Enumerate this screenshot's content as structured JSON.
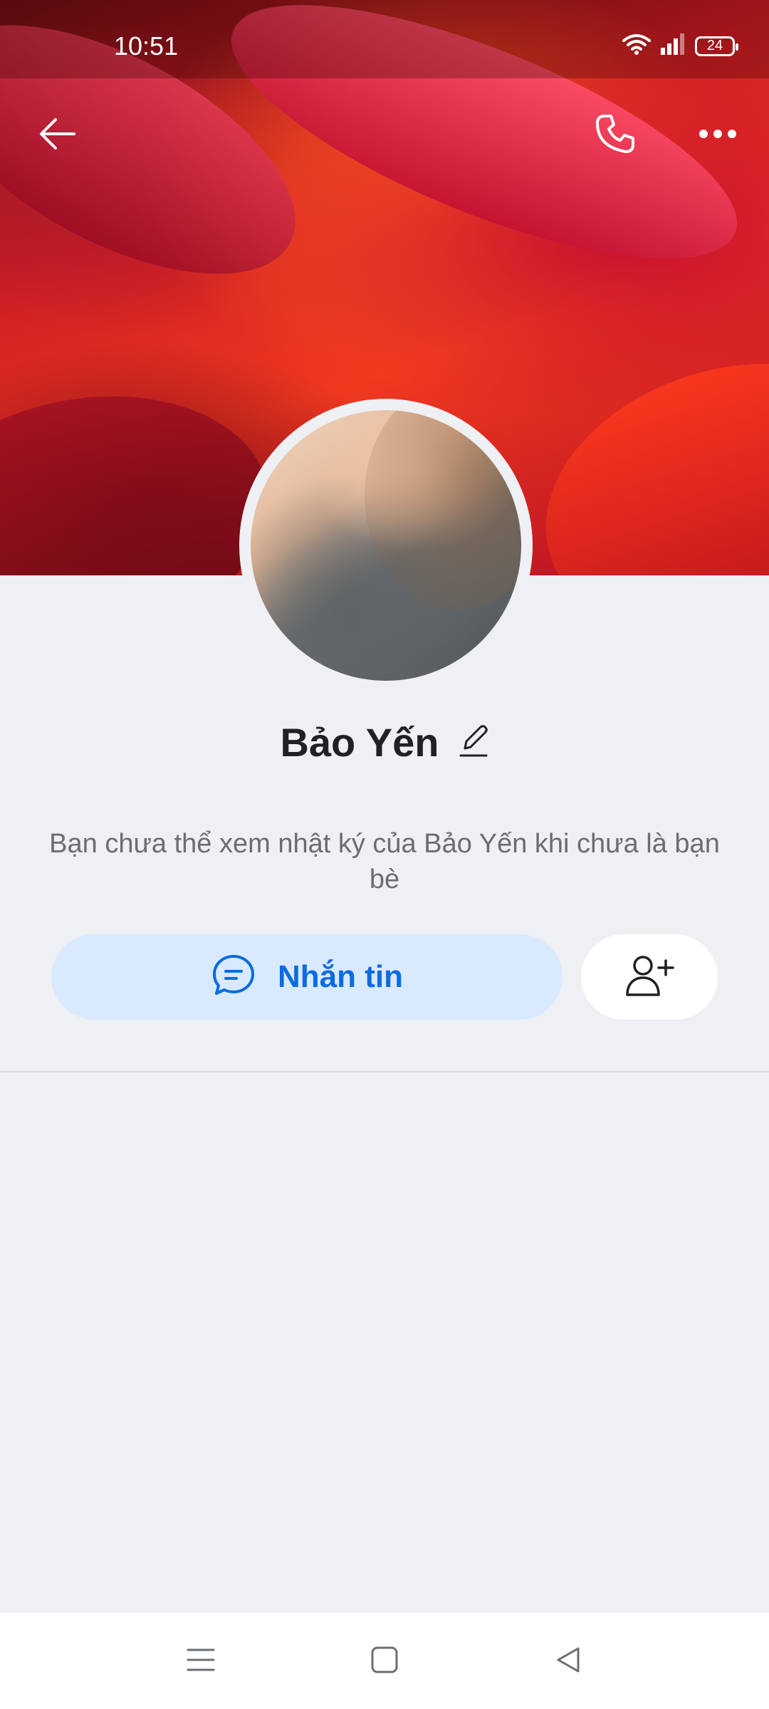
{
  "status_bar": {
    "time": "10:51",
    "battery": "24"
  },
  "header": {
    "back_icon": "arrow-left-icon",
    "call_icon": "phone-icon",
    "more_icon": "more-horizontal-icon"
  },
  "profile": {
    "name": "Bảo Yến",
    "edit_icon": "pencil-icon",
    "notice": "Bạn chưa thể xem nhật ký của Bảo Yến khi chưa là bạn bè"
  },
  "actions": {
    "message_label": "Nhắn tin",
    "message_icon": "chat-bubble-icon",
    "add_friend_icon": "user-plus-icon"
  },
  "colors": {
    "accent": "#0b6ce0",
    "message_button_bg": "#d9e9fe",
    "page_bg": "#eff0f4"
  },
  "nav_bar": {
    "icons": [
      "menu-icon",
      "home-square-icon",
      "back-triangle-icon"
    ]
  }
}
